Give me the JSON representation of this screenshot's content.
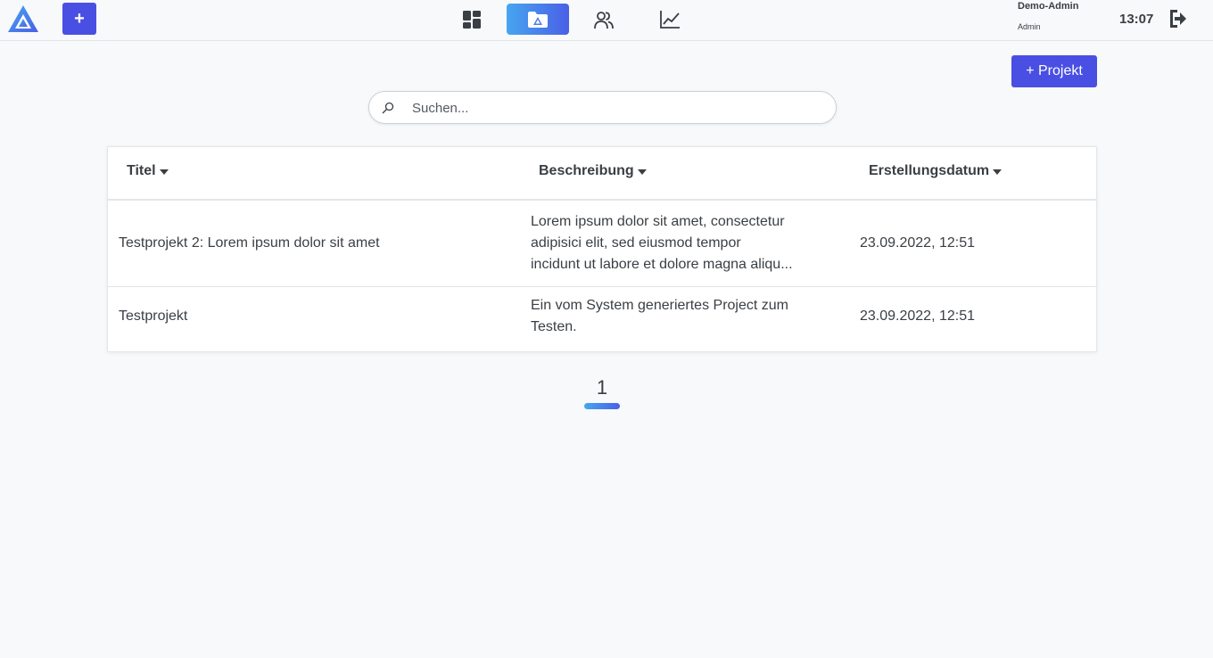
{
  "header": {
    "logo_icon": "app-logo-icon",
    "add_label": "+",
    "nav": [
      {
        "name": "dashboard",
        "icon": "dashboard-grid-icon",
        "active": false
      },
      {
        "name": "projects",
        "icon": "folder-icon",
        "active": true
      },
      {
        "name": "users",
        "icon": "users-icon",
        "active": false
      },
      {
        "name": "statistics",
        "icon": "line-chart-icon",
        "active": false
      }
    ],
    "user_name": "Demo-Admin",
    "user_role": "Admin",
    "clock": "13:07",
    "logout_icon": "logout-icon"
  },
  "toolbar": {
    "new_project_label": "+ Projekt"
  },
  "search": {
    "placeholder": "Suchen...",
    "value": ""
  },
  "table": {
    "columns": [
      "Titel",
      "Beschreibung",
      "Erstellungsdatum"
    ],
    "rows": [
      {
        "title": "Testprojekt 2: Lorem ipsum dolor sit amet",
        "desc_line1": "Lorem ipsum dolor sit amet, consectetur",
        "desc_line2": "adipisici elit, sed eiusmod tempor",
        "desc_line3": "incidunt ut labore et dolore magna aliqu...",
        "date": "23.09.2022, 12:51"
      },
      {
        "title": "Testprojekt",
        "desc_line1": "Ein vom System generiertes Project zum",
        "desc_line2": "Testen.",
        "date": "23.09.2022, 12:51"
      }
    ]
  },
  "pagination": {
    "current_page": "1"
  },
  "colors": {
    "accent": "#4a4fe3",
    "gradient_start": "#46a6f0",
    "gradient_end": "#4a5fe6",
    "background": "#f7f9fa",
    "text": "#3a3f44"
  }
}
